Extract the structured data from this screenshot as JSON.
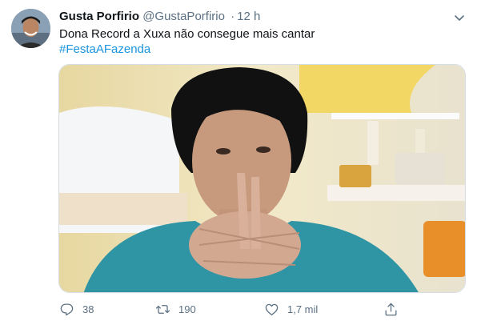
{
  "tweet": {
    "author_name": "Gusta Porfirio",
    "author_handle": "@GustaPorfirio",
    "separator": "·",
    "timestamp": "12 h",
    "text": "Dona Record a Xuxa não consegue mais cantar",
    "hashtag": "#FestaAFazenda"
  },
  "actions": {
    "reply_count": "38",
    "retweet_count": "190",
    "like_count": "1,7 mil"
  },
  "icons": {
    "more": "chevron-down-icon",
    "reply": "reply-icon",
    "retweet": "retweet-icon",
    "like": "heart-icon",
    "share": "share-icon"
  },
  "colors": {
    "text": "#0f1419",
    "secondary": "#5b7083",
    "link": "#1b95e0"
  }
}
